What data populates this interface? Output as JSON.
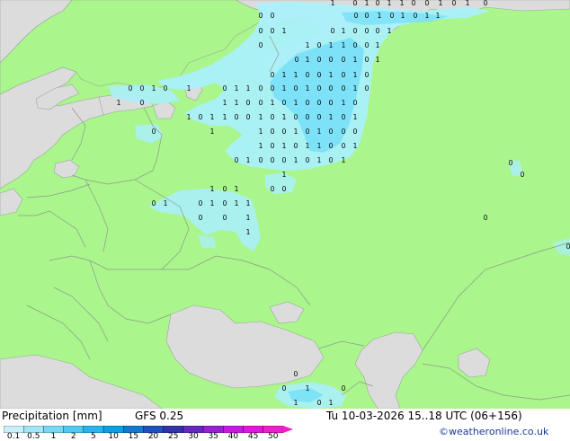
{
  "footer": {
    "title": "Precipitation [mm]",
    "model": "GFS 0.25",
    "valid": "Tu 10-03-2026 15..18 UTC (06+156)",
    "credit": "©weatheronline.co.uk"
  },
  "legend": {
    "ticks": [
      "0.1",
      "0.5",
      "1",
      "2",
      "5",
      "10",
      "15",
      "20",
      "25",
      "30",
      "35",
      "40",
      "45",
      "50"
    ],
    "colors": [
      "#c8f0fa",
      "#a0e6f8",
      "#78d8f4",
      "#50c8f0",
      "#28b4ec",
      "#0aa0e6",
      "#1478d2",
      "#1e50be",
      "#3232aa",
      "#6428be",
      "#9620d2",
      "#c818e6",
      "#e614dc",
      "#f01ec8"
    ]
  },
  "colors": {
    "land": "#aaf58c",
    "sea": "#dcdcdc",
    "border": "#8c9c8c",
    "precip_light": "#aaf0fa",
    "precip_medium": "#78e0f8"
  },
  "station_values": [
    "0",
    "0",
    "1",
    "0",
    "1",
    "0",
    "1",
    "1",
    "0",
    "0",
    "1",
    "0",
    "1",
    "0"
  ]
}
